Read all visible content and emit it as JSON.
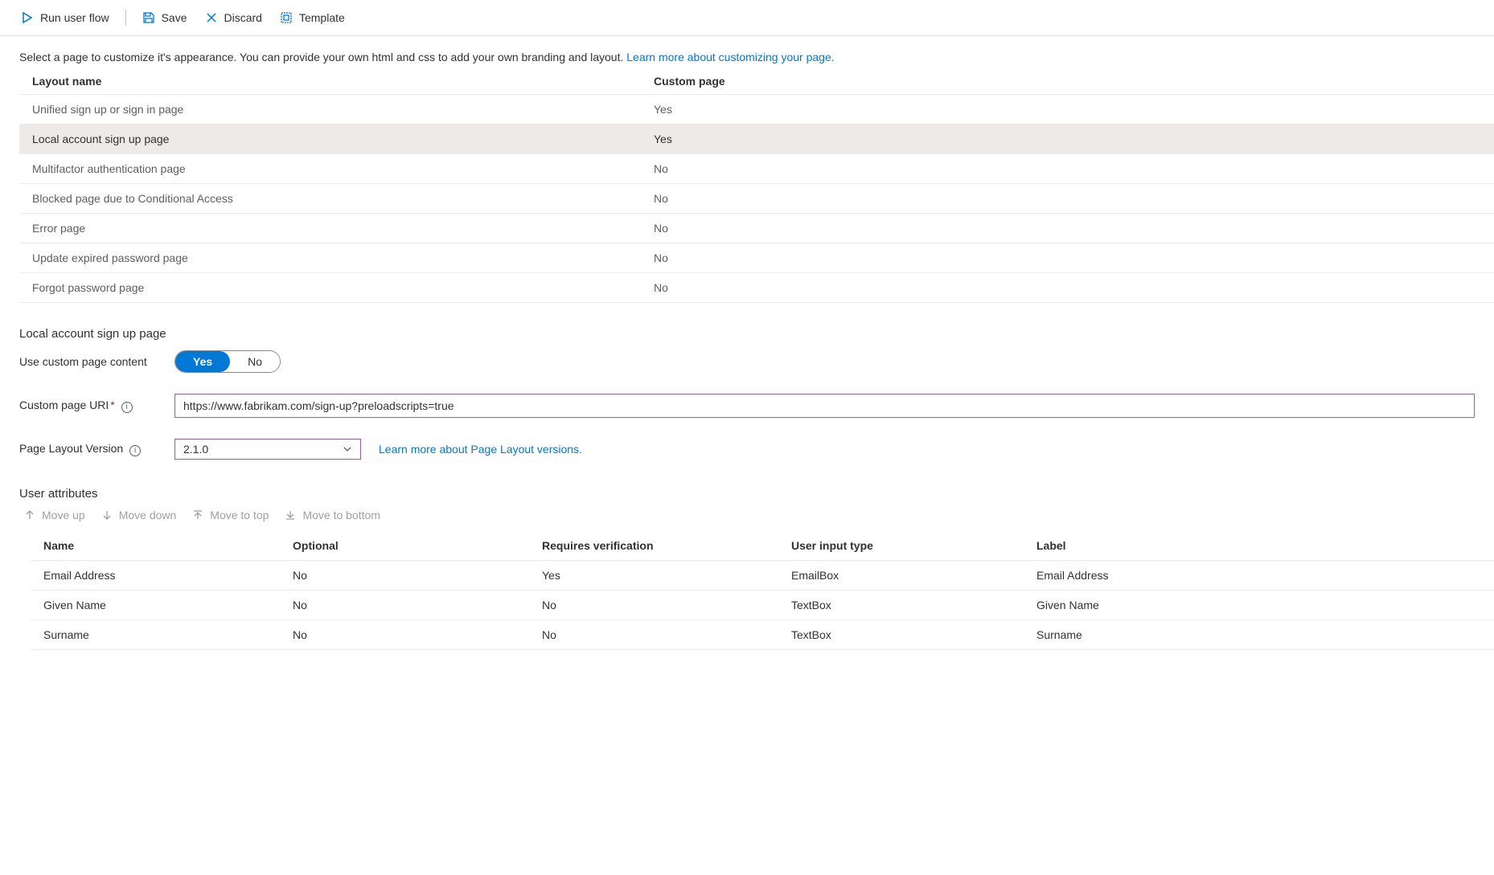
{
  "toolbar": {
    "run": "Run user flow",
    "save": "Save",
    "discard": "Discard",
    "template": "Template"
  },
  "description": {
    "text": "Select a page to customize it's appearance. You can provide your own html and css to add your own branding and layout. ",
    "link": "Learn more about customizing your page."
  },
  "layoutTable": {
    "headers": {
      "name": "Layout name",
      "custom": "Custom page"
    },
    "rows": [
      {
        "name": "Unified sign up or sign in page",
        "custom": "Yes"
      },
      {
        "name": "Local account sign up page",
        "custom": "Yes"
      },
      {
        "name": "Multifactor authentication page",
        "custom": "No"
      },
      {
        "name": "Blocked page due to Conditional Access",
        "custom": "No"
      },
      {
        "name": "Error page",
        "custom": "No"
      },
      {
        "name": "Update expired password page",
        "custom": "No"
      },
      {
        "name": "Forgot password page",
        "custom": "No"
      }
    ]
  },
  "detail": {
    "title": "Local account sign up page",
    "useCustomLabel": "Use custom page content",
    "toggle": {
      "yes": "Yes",
      "no": "No"
    },
    "uriLabel": "Custom page URI",
    "uriValue": "https://www.fabrikam.com/sign-up?preloadscripts=true",
    "versionLabel": "Page Layout Version",
    "versionValue": "2.1.0",
    "versionLink": "Learn more about Page Layout versions."
  },
  "attributes": {
    "title": "User attributes",
    "toolbar": {
      "moveUp": "Move up",
      "moveDown": "Move down",
      "moveTop": "Move to top",
      "moveBottom": "Move to bottom"
    },
    "headers": {
      "name": "Name",
      "optional": "Optional",
      "verification": "Requires verification",
      "type": "User input type",
      "label": "Label"
    },
    "rows": [
      {
        "name": "Email Address",
        "optional": "No",
        "verification": "Yes",
        "type": "EmailBox",
        "label": "Email Address"
      },
      {
        "name": "Given Name",
        "optional": "No",
        "verification": "No",
        "type": "TextBox",
        "label": "Given Name"
      },
      {
        "name": "Surname",
        "optional": "No",
        "verification": "No",
        "type": "TextBox",
        "label": "Surname"
      }
    ]
  }
}
